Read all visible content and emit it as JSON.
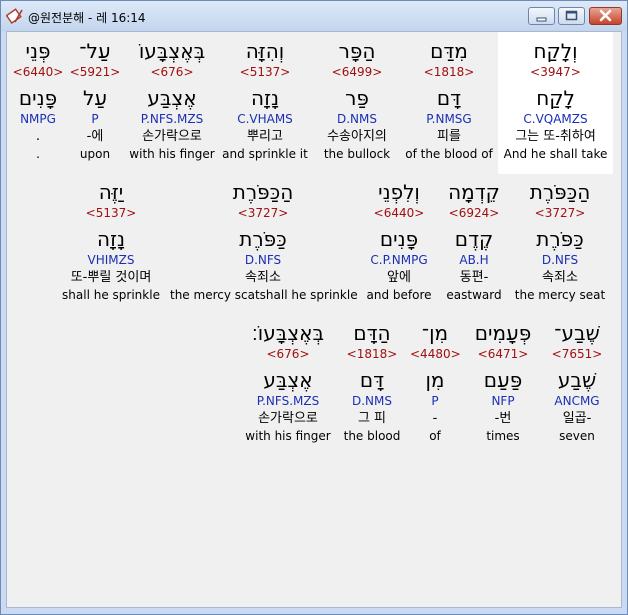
{
  "window": {
    "title": "@원전분해 - 레 16:14",
    "icons": {
      "app": "book-pen-icon",
      "minimize": "minimize-icon",
      "maximize": "maximize-icon",
      "close": "close-icon"
    }
  },
  "rows": [
    [
      {
        "heb": "פְּנֵי",
        "strong": "<6440>",
        "lemma": "פָּנִים",
        "morph": "NMPG",
        "kor": ".",
        "eng": "."
      },
      {
        "heb": "עַל־",
        "strong": "<5921>",
        "lemma": "עַל",
        "morph": "P",
        "kor": "-에",
        "eng": "upon"
      },
      {
        "heb": "בְּאֶצְבָּעוֹ",
        "strong": "<676>",
        "lemma": "אֶצְבַּע",
        "morph": "P.NFS.MZS",
        "kor": "손가락으로",
        "eng": "with his finger"
      },
      {
        "heb": "וְהִזָּה",
        "strong": "<5137>",
        "lemma": "נָזָה",
        "morph": "C.VHAMS",
        "kor": "뿌리고",
        "eng": "and sprinkle it"
      },
      {
        "heb": "הַפָּר",
        "strong": "<6499>",
        "lemma": "פַּר",
        "morph": "D.NMS",
        "kor": "수송아지의",
        "eng": "the bullock"
      },
      {
        "heb": "מִדַּם",
        "strong": "<1818>",
        "lemma": "דָּם",
        "morph": "P.NMSG",
        "kor": "피를",
        "eng": "of the blood of"
      },
      {
        "heb": "וְלָקַח",
        "strong": "<3947>",
        "lemma": "לָקַח",
        "morph": "C.VQAMZS",
        "kor": "그는 또-취하여",
        "eng": "And he shall take",
        "hl": true
      }
    ],
    [
      {
        "heb": "יַזֶּה",
        "strong": "<5137>",
        "lemma": "נָזָה",
        "morph": "VHIMZS",
        "kor": "또-뿌릴 것이며",
        "eng": "shall he sprinkle"
      },
      {
        "heb": "הַכַּפֹּרֶת",
        "strong": "<3727>",
        "lemma": "כַּפֹּרֶת",
        "morph": "D.NFS",
        "kor": "속죄소",
        "eng": "the mercy scatshall he sprinkle"
      },
      {
        "heb": "וְלִפְנֵי",
        "strong": "<6440>",
        "lemma": "פָּנִים",
        "morph": "C.P.NMPG",
        "kor": "앞에",
        "eng": "and before"
      },
      {
        "heb": "קֵדְמָה",
        "strong": "<6924>",
        "lemma": "קֶדֶם",
        "morph": "AB.H",
        "kor": "동편-",
        "eng": "eastward"
      },
      {
        "heb": "הַכַּפֹּרֶת",
        "strong": "<3727>",
        "lemma": "כַּפֹּרֶת",
        "morph": "D.NFS",
        "kor": "속죄소",
        "eng": "the mercy seat"
      }
    ],
    [
      {
        "heb": "בְּאֶצְבָּעוֹ׃",
        "strong": "<676>",
        "lemma": "אֶצְבַּע",
        "morph": "P.NFS.MZS",
        "kor": "손가락으로",
        "eng": "with his finger"
      },
      {
        "heb": "הַדָּם",
        "strong": "<1818>",
        "lemma": "דָּם",
        "morph": "D.NMS",
        "kor": "그 피",
        "eng": "the blood"
      },
      {
        "heb": "מִן־",
        "strong": "<4480>",
        "lemma": "מִן",
        "morph": "P",
        "kor": "-",
        "eng": "of"
      },
      {
        "heb": "פְּעָמִים",
        "strong": "<6471>",
        "lemma": "פַּעַם",
        "morph": "NFP",
        "kor": "-번",
        "eng": "times"
      },
      {
        "heb": "שֶׁבַע־",
        "strong": "<7651>",
        "lemma": "שֶׁבַע",
        "morph": "ANCMG",
        "kor": "일곱-",
        "eng": "seven"
      }
    ]
  ]
}
